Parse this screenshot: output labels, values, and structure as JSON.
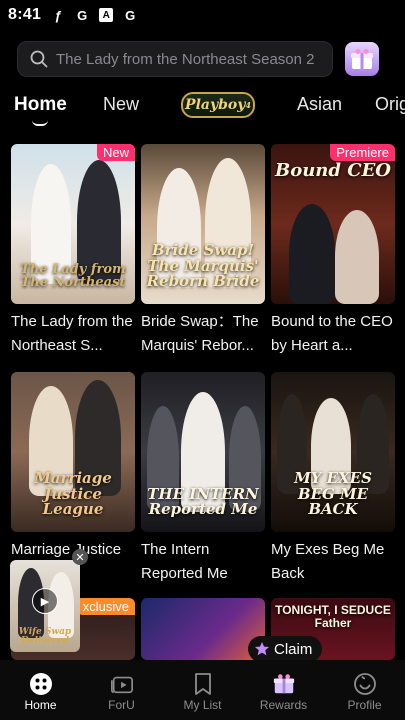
{
  "status": {
    "time": "8:41",
    "icons": [
      "f-icon",
      "g-icon",
      "a-icon",
      "g-icon"
    ]
  },
  "search": {
    "placeholder": "The Lady from the Northeast  Season 2"
  },
  "tabs": [
    "Home",
    "New",
    "Playboy",
    "Asian",
    "Orig"
  ],
  "cards": [
    {
      "title": "The Lady from the Northeast  S...",
      "poster_text": "The Lady from The Northeast",
      "badge": "New"
    },
    {
      "title": "Bride Swap：The Marquis' Rebor...",
      "poster_text": "Bride Swap! The Marquis' Reborn Bride",
      "badge": ""
    },
    {
      "title": "Bound to the CEO by Heart a...",
      "poster_text": "Bound CEO",
      "badge": "Premiere"
    },
    {
      "title": "Marriage Justice",
      "poster_text": "Marriage Justice League",
      "badge": ""
    },
    {
      "title": "The Intern Reported Me",
      "poster_text": "THE INTERN Reported Me",
      "badge": ""
    },
    {
      "title": "My Exes Beg Me Back",
      "poster_text": "MY EXES BEG ME BACK",
      "badge": ""
    },
    {
      "title": "",
      "poster_text": "",
      "badge": "xclusive"
    },
    {
      "title": "",
      "poster_text": "",
      "badge": ""
    },
    {
      "title": "",
      "poster_text": "TONIGHT, I SEDUCE Father",
      "badge": ""
    }
  ],
  "mini_player": {
    "text": "Wife Swap Delivered"
  },
  "claim": {
    "label": "Claim"
  },
  "nav": [
    {
      "label": "Home",
      "icon": "home-icon"
    },
    {
      "label": "ForU",
      "icon": "play-stack-icon"
    },
    {
      "label": "My List",
      "icon": "bookmark-icon"
    },
    {
      "label": "Rewards",
      "icon": "gift-icon"
    },
    {
      "label": "Profile",
      "icon": "smile-icon"
    }
  ],
  "colors": {
    "accent": "#ff2f6d",
    "background": "#000000",
    "nav_bg": "#0b0b0b"
  }
}
